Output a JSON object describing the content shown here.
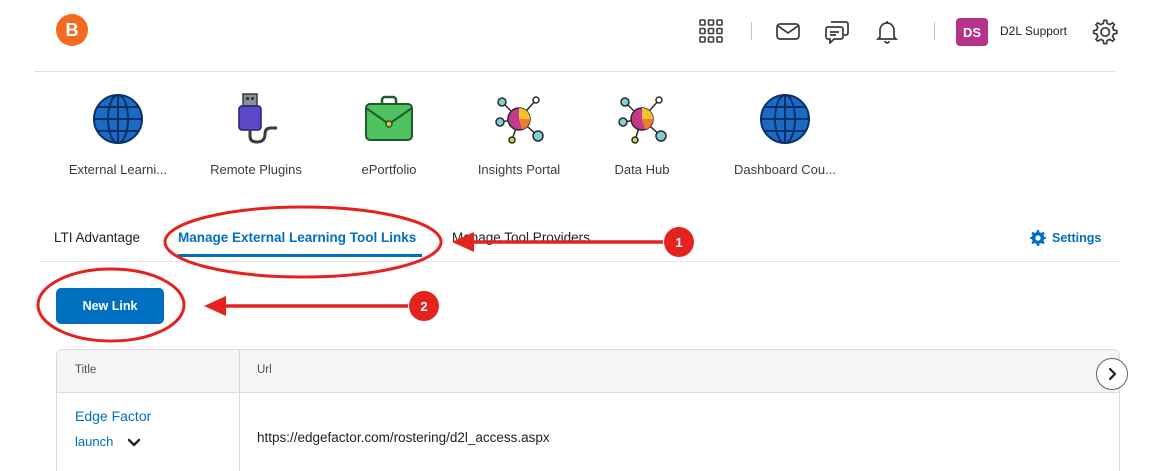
{
  "navbar": {
    "logo_letter": "B",
    "avatar_initials": "DS",
    "user_name": "D2L Support",
    "icons": [
      "grid-icon",
      "mail-icon",
      "chat-icon",
      "bell-icon",
      "gear-icon"
    ]
  },
  "tools": [
    {
      "label": "External Learni...",
      "icon": "globe-icon"
    },
    {
      "label": "Remote Plugins",
      "icon": "plug-icon"
    },
    {
      "label": "ePortfolio",
      "icon": "briefcase-icon"
    },
    {
      "label": "Insights Portal",
      "icon": "network-pie-icon"
    },
    {
      "label": "Data Hub",
      "icon": "network-pie-icon"
    },
    {
      "label": "Dashboard Cou...",
      "icon": "globe-icon"
    }
  ],
  "tabs": {
    "lti": "LTI Advantage",
    "manage": "Manage External Learning Tool Links",
    "providers": "Manage Tool Providers",
    "settings": "Settings"
  },
  "actions": {
    "new_link": "New Link"
  },
  "table": {
    "headers": [
      "Title",
      "Url"
    ],
    "rows": [
      {
        "title": "Edge Factor",
        "action": "launch",
        "url": "https://edgefactor.com/rostering/d2l_access.aspx"
      }
    ]
  },
  "annotations": {
    "badge1": "1",
    "badge2": "2"
  },
  "colors": {
    "accent": "#006fbf",
    "annotation": "#e4231f",
    "logo": "#f26b21",
    "avatar": "#b5338a"
  }
}
